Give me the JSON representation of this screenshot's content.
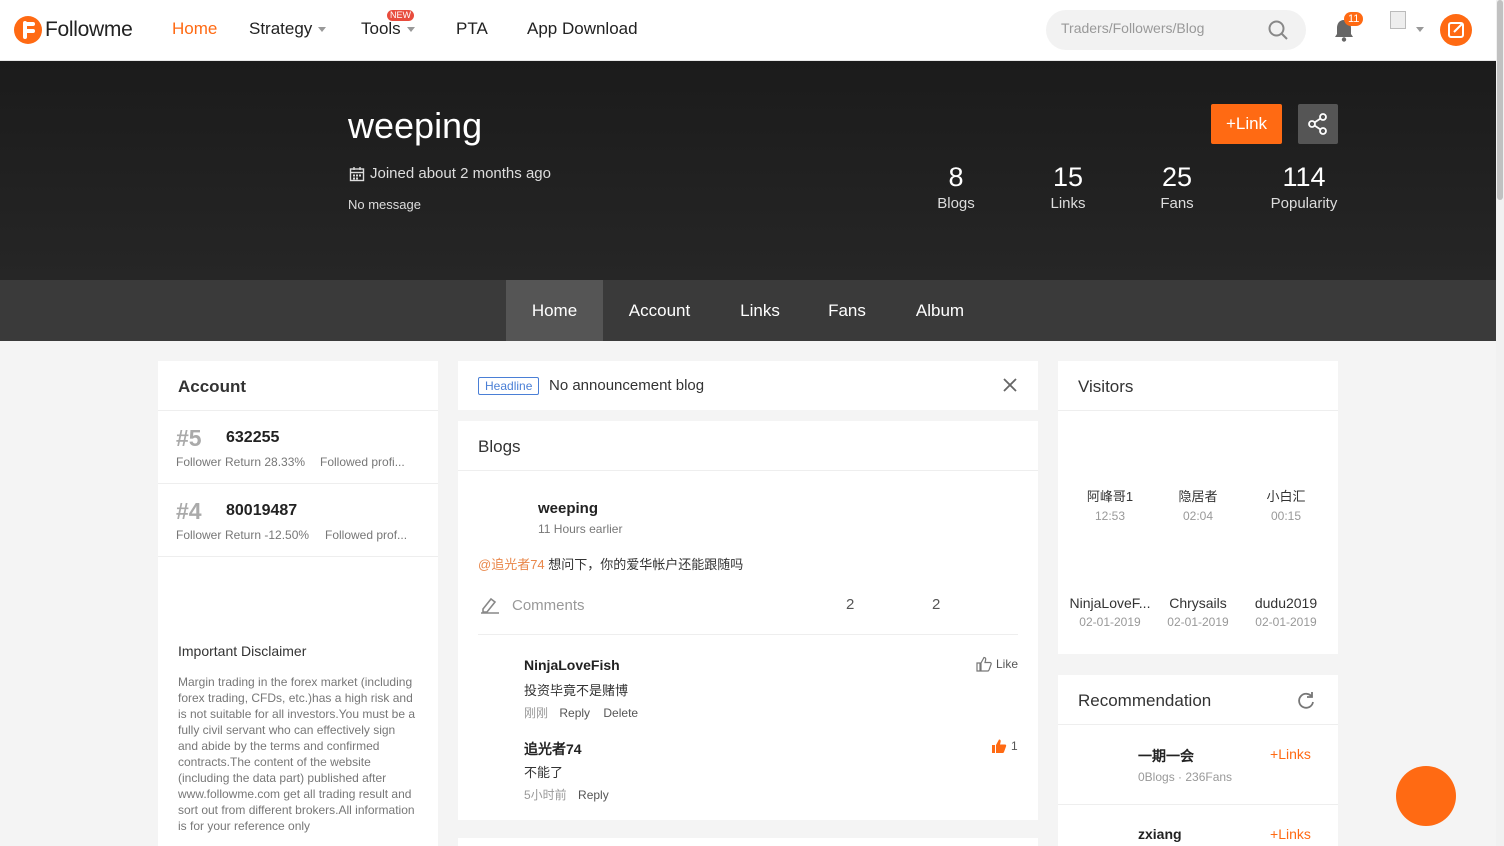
{
  "brand": {
    "name": "Followme",
    "accent": "#ff6a13"
  },
  "nav": {
    "items": [
      {
        "label": "Home"
      },
      {
        "label": "Strategy"
      },
      {
        "label": "Tools"
      },
      {
        "label": "PTA"
      },
      {
        "label": "App Download"
      }
    ],
    "new_badge": "NEW",
    "search_placeholder": "Traders/Followers/Blog",
    "notification_count": "11"
  },
  "profile": {
    "username": "weeping",
    "joined": "Joined about 2 months ago",
    "message": "No message",
    "link_label": "Link",
    "stats": [
      {
        "value": "8",
        "label": "Blogs"
      },
      {
        "value": "15",
        "label": "Links"
      },
      {
        "value": "25",
        "label": "Fans"
      },
      {
        "value": "114",
        "label": "Popularity"
      }
    ]
  },
  "tabs": [
    "Home",
    "Account",
    "Links",
    "Fans",
    "Album"
  ],
  "account_card": {
    "title": "Account",
    "accounts": [
      {
        "rank": "#5",
        "id": "632255",
        "role": "Follower",
        "return": "Return 28.33%",
        "followed": "Followed profi..."
      },
      {
        "rank": "#4",
        "id": "80019487",
        "role": "Follower",
        "return": "Return -12.50%",
        "followed": "Followed prof..."
      }
    ],
    "disclaimer_title": "Important Disclaimer",
    "disclaimer_text": "Margin trading in the forex market (including forex trading, CFDs, etc.)has a high risk and is not suitable for all investors.You must be a fully civil servant who can effectively sign and abide by the terms and confirmed contracts.The content of the website (including the data part) published after www.followme.com get all trading result and sort out from different brokers.All information is for your reference only"
  },
  "headline": {
    "tag": "Headline",
    "text": "No announcement blog"
  },
  "blogs": {
    "title": "Blogs",
    "post": {
      "author": "weeping",
      "time": "11 Hours earlier",
      "mention": "@追光者74",
      "body": " 想问下，你的爱华帐户还能跟随吗",
      "comments_label": "Comments",
      "count_a": "2",
      "count_b": "2"
    },
    "comments": [
      {
        "author": "NinjaLoveFish",
        "text": "投资毕竟不是赌博",
        "time": "刚刚",
        "reply": "Reply",
        "delete": "Delete",
        "like": "Like"
      },
      {
        "author": "追光者74",
        "text": "不能了",
        "time": "5小时前",
        "reply": "Reply",
        "like_count": "1"
      }
    ]
  },
  "visitors": {
    "title": "Visitors",
    "list": [
      {
        "name": "阿峰哥1",
        "time": "12:53"
      },
      {
        "name": "隐居者",
        "time": "02:04"
      },
      {
        "name": "小白汇",
        "time": "00:15"
      },
      {
        "name": "NinjaLoveF...",
        "time": "02-01-2019"
      },
      {
        "name": "Chrysails",
        "time": "02-01-2019"
      },
      {
        "name": "dudu2019",
        "time": "02-01-2019"
      }
    ]
  },
  "recommendation": {
    "title": "Recommendation",
    "items": [
      {
        "name": "一期一会",
        "meta": "0Blogs · 236Fans",
        "action": "Links"
      },
      {
        "name": "zxiang",
        "meta": "",
        "action": "Links"
      }
    ]
  }
}
